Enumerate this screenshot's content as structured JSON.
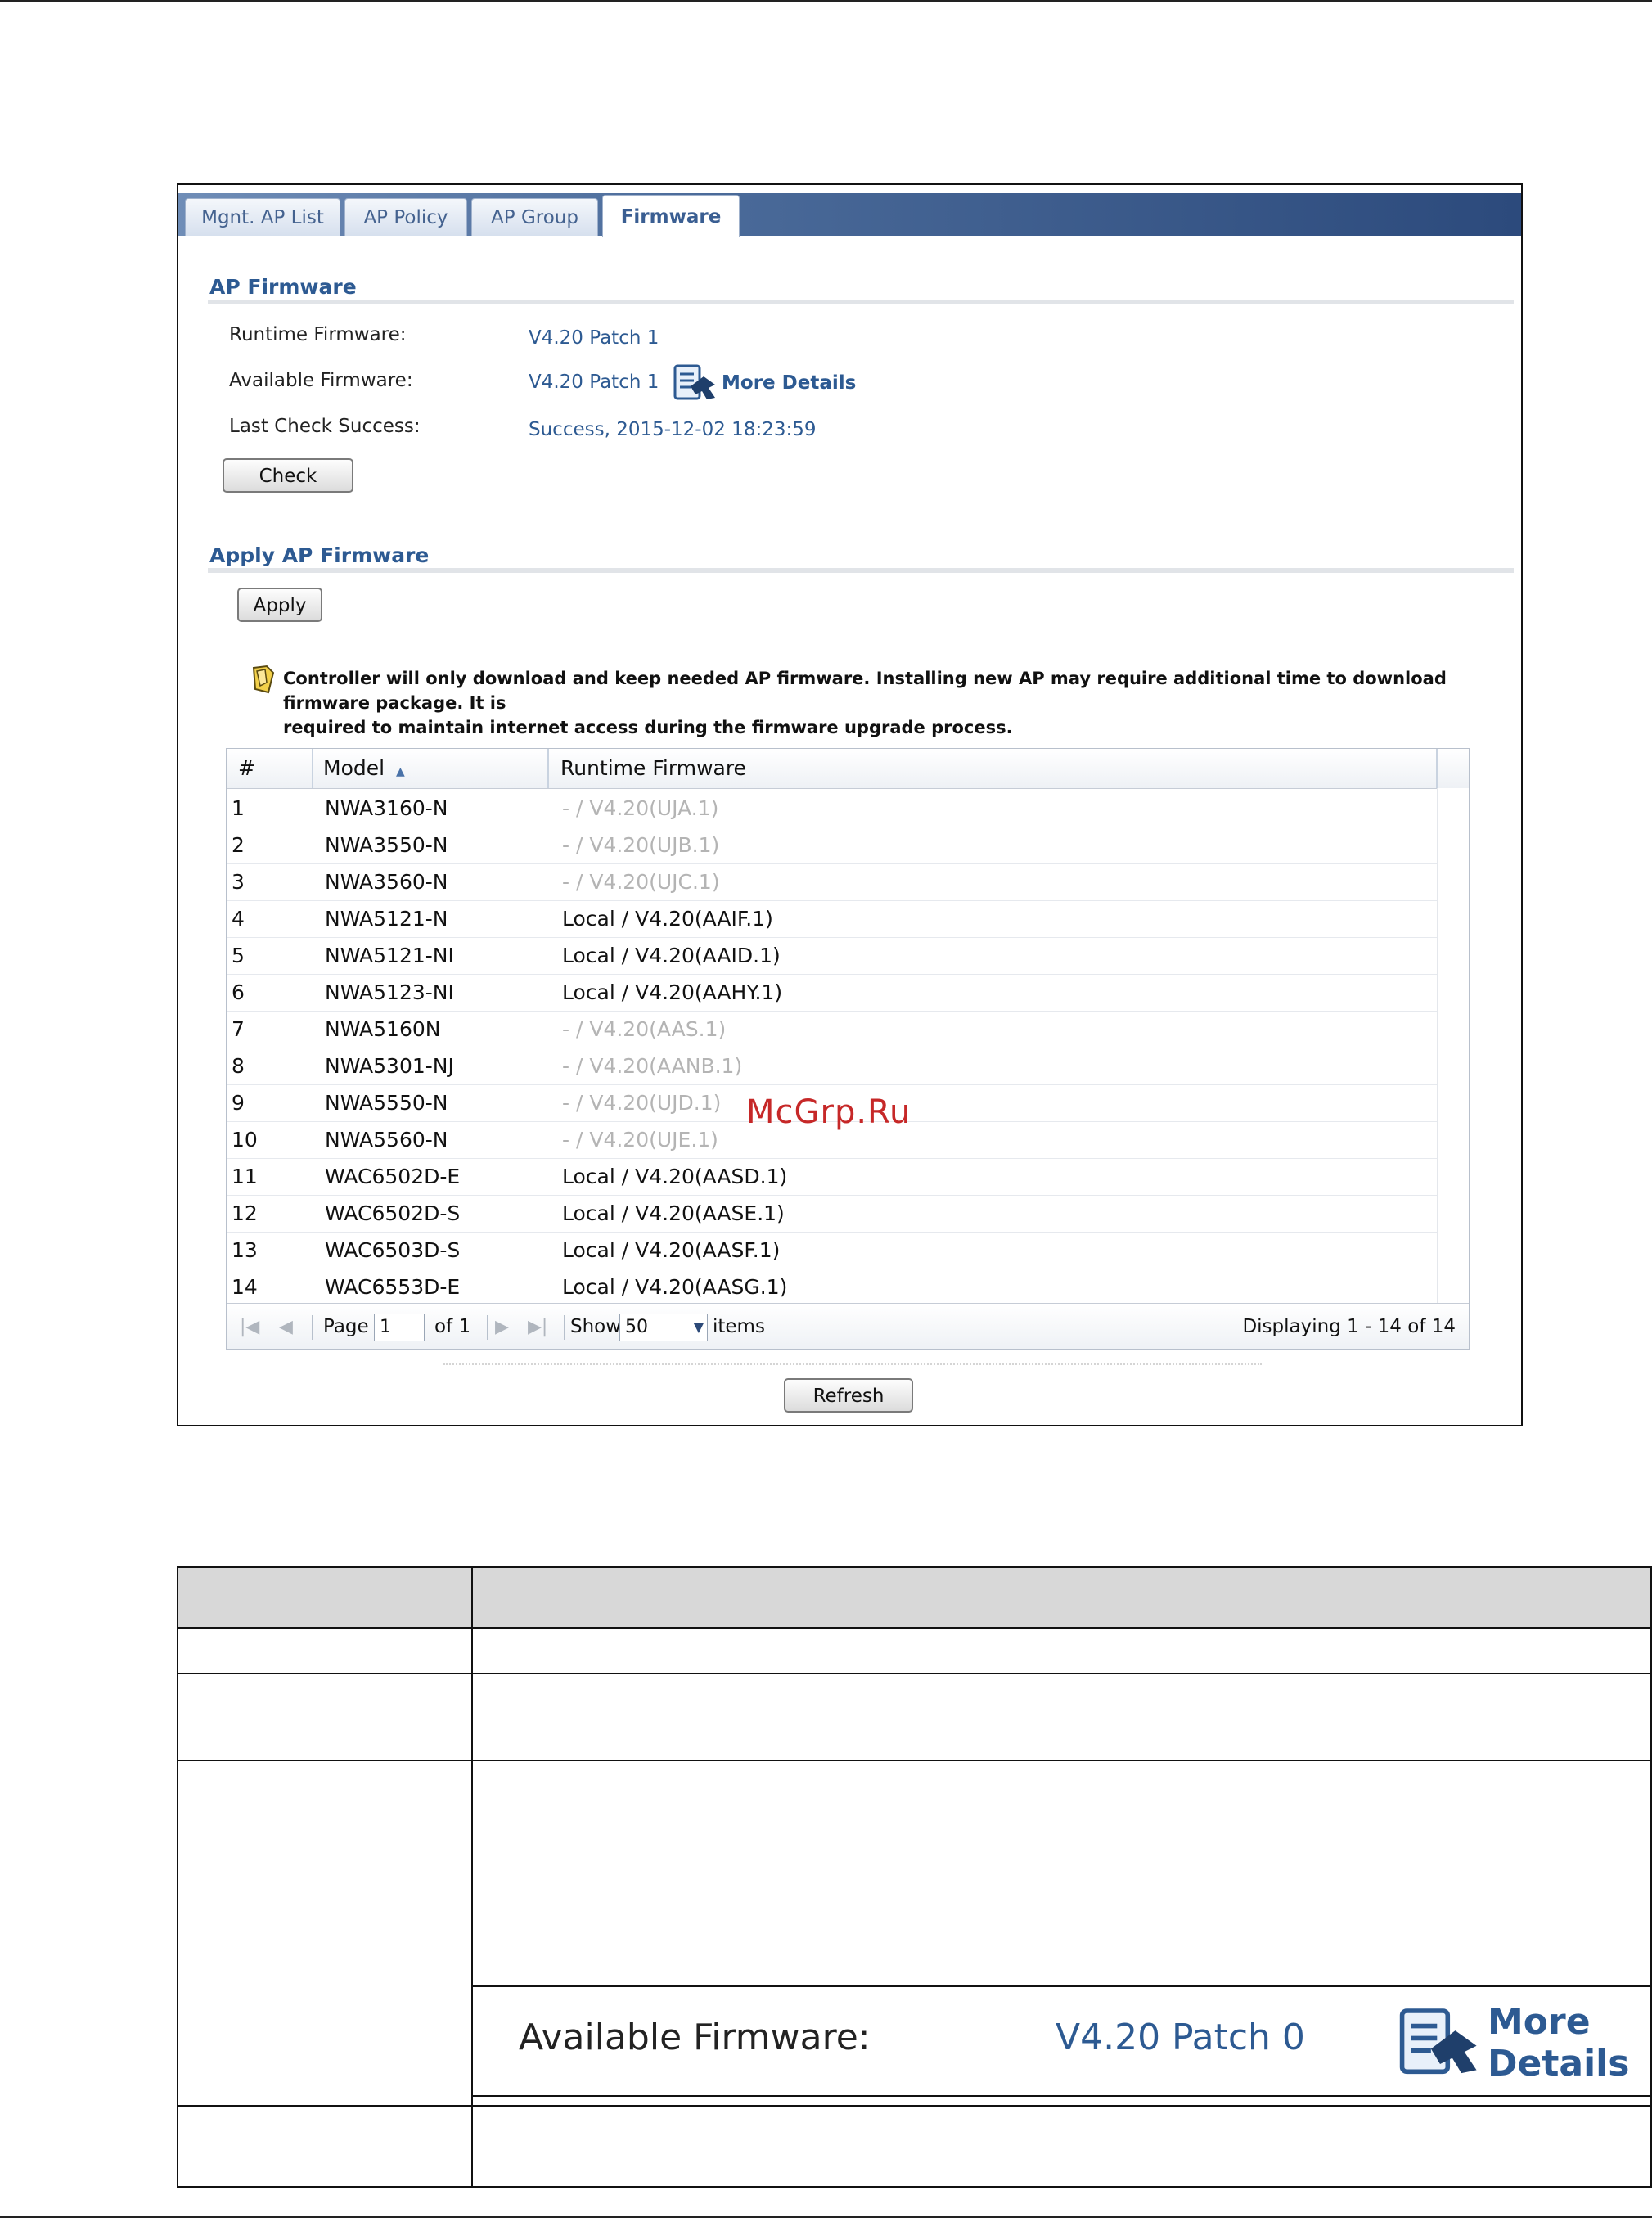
{
  "tabs": [
    "Mgnt. AP List",
    "AP Policy",
    "AP Group",
    "Firmware"
  ],
  "ap_firmware": {
    "title": "AP Firmware",
    "runtime_label": "Runtime Firmware:",
    "runtime_value": "V4.20 Patch 1",
    "available_label": "Available Firmware:",
    "available_value": "V4.20 Patch 1",
    "more_details": "More Details",
    "last_check_label": "Last Check Success:",
    "last_check_value": "Success, 2015-12-02 18:23:59",
    "check_button": "Check"
  },
  "apply_firmware": {
    "title": "Apply AP Firmware",
    "apply_button": "Apply",
    "note_line1": "Controller will only download and keep needed AP firmware. Installing new AP may require additional time to download firmware package. It is",
    "note_line2": "required to maintain internet access during the firmware upgrade process."
  },
  "grid": {
    "columns": [
      "#",
      "Model",
      "Runtime Firmware"
    ],
    "sort_indicator": "▲",
    "rows": [
      {
        "n": "1",
        "model": "NWA3160-N",
        "fw": "- / V4.20(UJA.1)",
        "dim": true
      },
      {
        "n": "2",
        "model": "NWA3550-N",
        "fw": "- / V4.20(UJB.1)",
        "dim": true
      },
      {
        "n": "3",
        "model": "NWA3560-N",
        "fw": "- / V4.20(UJC.1)",
        "dim": true
      },
      {
        "n": "4",
        "model": "NWA5121-N",
        "fw": "Local / V4.20(AAIF.1)",
        "dim": false
      },
      {
        "n": "5",
        "model": "NWA5121-NI",
        "fw": "Local / V4.20(AAID.1)",
        "dim": false
      },
      {
        "n": "6",
        "model": "NWA5123-NI",
        "fw": "Local / V4.20(AAHY.1)",
        "dim": false
      },
      {
        "n": "7",
        "model": "NWA5160N",
        "fw": "- / V4.20(AAS.1)",
        "dim": true
      },
      {
        "n": "8",
        "model": "NWA5301-NJ",
        "fw": "- / V4.20(AANB.1)",
        "dim": true
      },
      {
        "n": "9",
        "model": "NWA5550-N",
        "fw": "- / V4.20(UJD.1)",
        "dim": true
      },
      {
        "n": "10",
        "model": "NWA5560-N",
        "fw": "- / V4.20(UJE.1)",
        "dim": true
      },
      {
        "n": "11",
        "model": "WAC6502D-E",
        "fw": "Local / V4.20(AASD.1)",
        "dim": false
      },
      {
        "n": "12",
        "model": "WAC6502D-S",
        "fw": "Local / V4.20(AASE.1)",
        "dim": false
      },
      {
        "n": "13",
        "model": "WAC6503D-S",
        "fw": "Local / V4.20(AASF.1)",
        "dim": false
      },
      {
        "n": "14",
        "model": "WAC6553D-E",
        "fw": "Local / V4.20(AASG.1)",
        "dim": false
      }
    ],
    "pager": {
      "page_label": "Page",
      "page_value": "1",
      "of_label": "of 1",
      "show_label": "Show",
      "show_value": "50",
      "items_label": "items",
      "displaying": "Displaying 1 - 14 of 14"
    }
  },
  "refresh_button": "Refresh",
  "inset": {
    "label": "Available Firmware:",
    "value": "V4.20 Patch 0",
    "more_details": "More Details"
  },
  "watermark": "McGrp.Ru"
}
